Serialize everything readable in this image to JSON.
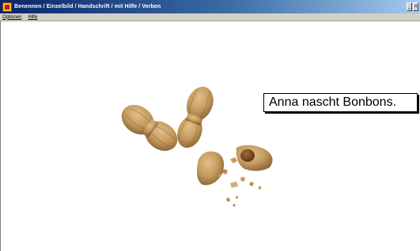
{
  "window": {
    "title": "Benennen / Einzelbild / Handschrift / mit Hilfe / Verben"
  },
  "menu": {
    "items": [
      {
        "label": "Optionen"
      },
      {
        "label": "Hilfe"
      }
    ]
  },
  "content": {
    "sentence": "Anna nascht Bonbons.",
    "image": "peanuts-image"
  },
  "colors": {
    "title_start": "#0a246a",
    "title_end": "#a6caf0",
    "menu_bg": "#d4d0c8",
    "peanut_shell": "#c49a5e"
  }
}
